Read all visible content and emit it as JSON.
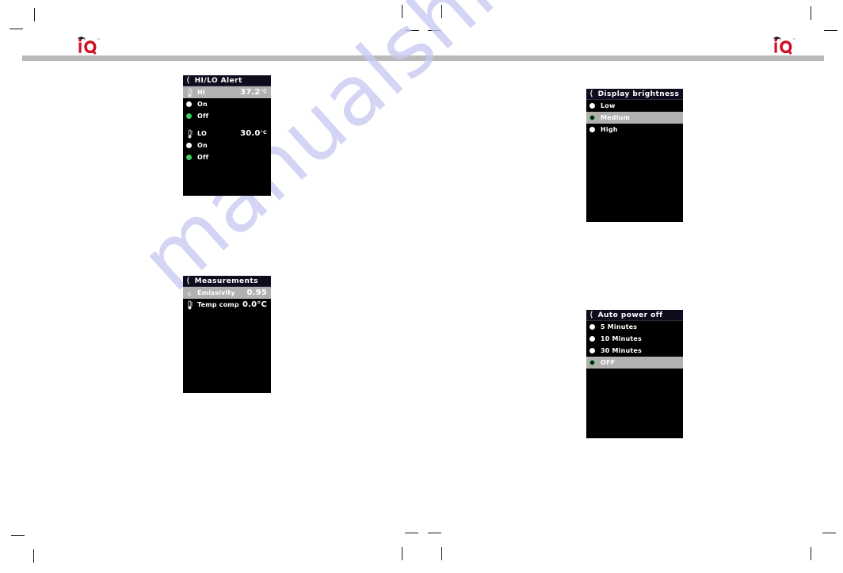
{
  "page": {
    "watermark": "manualshive.com",
    "brand_logo_alt": "IQ"
  },
  "panels": {
    "hilo": {
      "title": "HI/LO Alert",
      "back_icon": "chevron-left-icon",
      "rows": [
        {
          "name": "hi-value",
          "icon": "thermometer-icon",
          "label": "HI",
          "value": "37.2",
          "unit": "°C",
          "selected": true
        },
        {
          "name": "hi-on",
          "icon": "radio-filled",
          "label": "On",
          "state": "white"
        },
        {
          "name": "hi-off",
          "icon": "radio-filled",
          "label": "Off",
          "state": "green"
        },
        {
          "name": "lo-value",
          "icon": "thermometer-icon",
          "label": "LO",
          "value": "30.0",
          "unit": "°C",
          "selected": false
        },
        {
          "name": "lo-on",
          "icon": "radio-filled",
          "label": "On",
          "state": "white"
        },
        {
          "name": "lo-off",
          "icon": "radio-filled",
          "label": "Off",
          "state": "green"
        }
      ]
    },
    "measurements": {
      "title": "Measurements",
      "back_icon": "chevron-left-icon",
      "rows": [
        {
          "name": "emissivity",
          "icon": "epsilon-icon",
          "label": "Emissivity",
          "value": "0.95",
          "selected": true
        },
        {
          "name": "temp-comp",
          "icon": "thermometer-icon",
          "label": "Temp comp",
          "value": "0.0°C",
          "selected": false
        }
      ]
    },
    "brightness": {
      "title": "Display brightness",
      "back_icon": "chevron-left-icon",
      "rows": [
        {
          "name": "brightness-low",
          "label": "Low",
          "state": "white",
          "selected": false
        },
        {
          "name": "brightness-medium",
          "label": "Medium",
          "state": "ring",
          "selected": true
        },
        {
          "name": "brightness-high",
          "label": "High",
          "state": "white",
          "selected": false
        }
      ]
    },
    "auto_power_off": {
      "title": "Auto power off",
      "back_icon": "chevron-left-icon",
      "rows": [
        {
          "name": "apo-5min",
          "label": "5 Minutes",
          "state": "white",
          "selected": false
        },
        {
          "name": "apo-10min",
          "label": "10 Minutes",
          "state": "white",
          "selected": false
        },
        {
          "name": "apo-30min",
          "label": "30 Minutes",
          "state": "white",
          "selected": false
        },
        {
          "name": "apo-off",
          "label": "OFF",
          "state": "ring",
          "selected": true
        }
      ]
    }
  },
  "colors": {
    "accent_green": "#3fcc63",
    "selection_gray": "#b1b1b1",
    "panel_black": "#000000",
    "titlebar": "#0d0d1e",
    "brand_red": "#cf1125",
    "rule_gray": "#b9b9b9",
    "watermark": "#c9caf2"
  }
}
